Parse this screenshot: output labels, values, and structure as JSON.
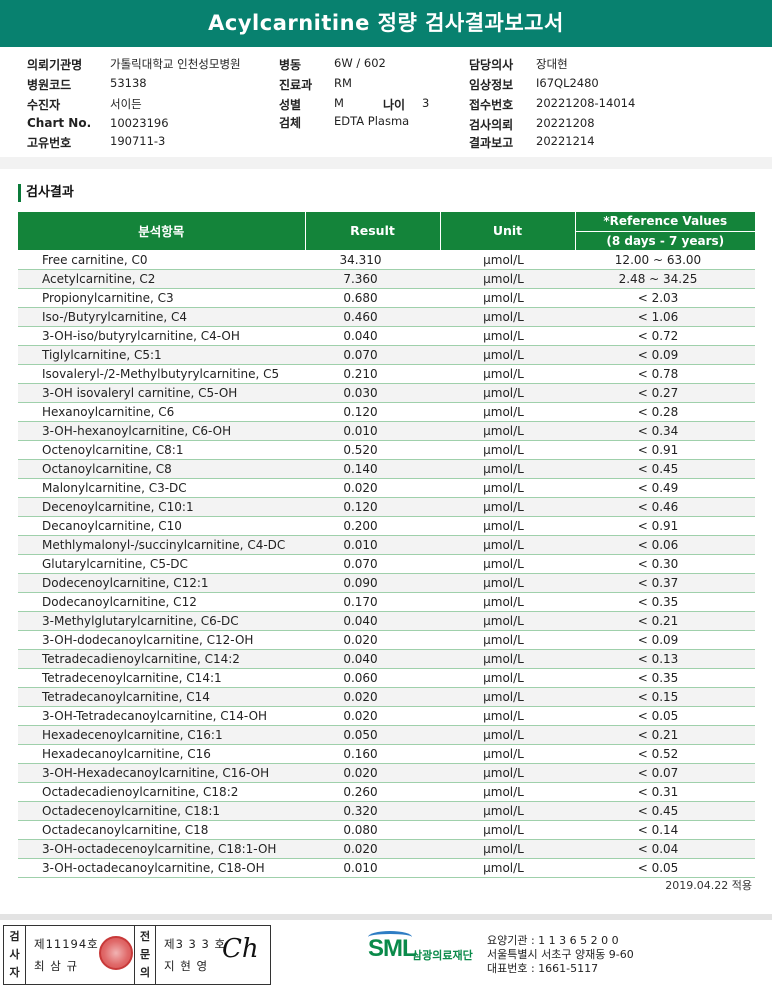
{
  "report": {
    "title": "Acylcarnitine 정량 검사결과보고서"
  },
  "patient_info": {
    "col1": [
      {
        "label": "의뢰기관명",
        "value": "가톨릭대학교 인천성모병원"
      },
      {
        "label": "병원코드",
        "value": "53138"
      },
      {
        "label": "수진자",
        "value": "서이든"
      },
      {
        "label": "Chart No.",
        "value": "10023196"
      },
      {
        "label": "고유번호",
        "value": "190711-3"
      }
    ],
    "col2": [
      {
        "label": "병동",
        "value": "6W / 602"
      },
      {
        "label": "진료과",
        "value": "RM"
      },
      {
        "label": "성별",
        "value": "M"
      },
      {
        "label": "검체",
        "value": "EDTA Plasma"
      }
    ],
    "age": {
      "label": "나이",
      "value": "3"
    },
    "col3": [
      {
        "label": "담당의사",
        "value": "장대현"
      },
      {
        "label": "임상정보",
        "value": "I67QL2480"
      },
      {
        "label": "접수번호",
        "value": "20221208-14014"
      },
      {
        "label": "검사의뢰",
        "value": "20221208"
      },
      {
        "label": "결과보고",
        "value": "20221214"
      }
    ]
  },
  "section": {
    "title": "검사결과"
  },
  "table": {
    "headers": {
      "item": "분석항목",
      "result": "Result",
      "unit": "Unit",
      "ref_title": "*Reference Values",
      "ref_range": "(8 days - 7 years)"
    },
    "rows": [
      {
        "name": "Free carnitine, C0",
        "result": "34.310",
        "unit": "μmol/L",
        "ref": "12.00 ~ 63.00"
      },
      {
        "name": "Acetylcarnitine, C2",
        "result": "7.360",
        "unit": "μmol/L",
        "ref": "2.48 ~ 34.25"
      },
      {
        "name": "Propionylcarnitine, C3",
        "result": "0.680",
        "unit": "μmol/L",
        "ref": "< 2.03"
      },
      {
        "name": "Iso-/Butyrylcarnitine, C4",
        "result": "0.460",
        "unit": "μmol/L",
        "ref": "< 1.06"
      },
      {
        "name": "3-OH-iso/butyrylcarnitine, C4-OH",
        "result": "0.040",
        "unit": "μmol/L",
        "ref": "< 0.72"
      },
      {
        "name": "Tiglylcarnitine, C5:1",
        "result": "0.070",
        "unit": "μmol/L",
        "ref": "< 0.09"
      },
      {
        "name": "Isovaleryl-/2-Methylbutyrylcarnitine, C5",
        "result": "0.210",
        "unit": "μmol/L",
        "ref": "< 0.78"
      },
      {
        "name": "3-OH isovaleryl carnitine, C5-OH",
        "result": "0.030",
        "unit": "μmol/L",
        "ref": "< 0.27"
      },
      {
        "name": "Hexanoylcarnitine, C6",
        "result": "0.120",
        "unit": "μmol/L",
        "ref": "< 0.28"
      },
      {
        "name": "3-OH-hexanoylcarnitine, C6-OH",
        "result": "0.010",
        "unit": "μmol/L",
        "ref": "< 0.34"
      },
      {
        "name": "Octenoylcarnitine, C8:1",
        "result": "0.520",
        "unit": "μmol/L",
        "ref": "< 0.91"
      },
      {
        "name": "Octanoylcarnitine, C8",
        "result": "0.140",
        "unit": "μmol/L",
        "ref": "< 0.45"
      },
      {
        "name": "Malonylcarnitine, C3-DC",
        "result": "0.020",
        "unit": "μmol/L",
        "ref": "< 0.49"
      },
      {
        "name": "Decenoylcarnitine, C10:1",
        "result": "0.120",
        "unit": "μmol/L",
        "ref": "< 0.46"
      },
      {
        "name": "Decanoylcarnitine, C10",
        "result": "0.200",
        "unit": "μmol/L",
        "ref": "< 0.91"
      },
      {
        "name": "Methlymalonyl-/succinylcarnitine, C4-DC",
        "result": "0.010",
        "unit": "μmol/L",
        "ref": "< 0.06"
      },
      {
        "name": "Glutarylcarnitine, C5-DC",
        "result": "0.070",
        "unit": "μmol/L",
        "ref": "< 0.30"
      },
      {
        "name": "Dodecenoylcarnitine, C12:1",
        "result": "0.090",
        "unit": "μmol/L",
        "ref": "< 0.37"
      },
      {
        "name": "Dodecanoylcarnitine, C12",
        "result": "0.170",
        "unit": "μmol/L",
        "ref": "< 0.35"
      },
      {
        "name": "3-Methylglutarylcarnitine, C6-DC",
        "result": "0.040",
        "unit": "μmol/L",
        "ref": "< 0.21"
      },
      {
        "name": "3-OH-dodecanoylcarnitine, C12-OH",
        "result": "0.020",
        "unit": "μmol/L",
        "ref": "< 0.09"
      },
      {
        "name": "Tetradecadienoylcarnitine, C14:2",
        "result": "0.040",
        "unit": "μmol/L",
        "ref": "< 0.13"
      },
      {
        "name": "Tetradecenoylcarnitine, C14:1",
        "result": "0.060",
        "unit": "μmol/L",
        "ref": "< 0.35"
      },
      {
        "name": "Tetradecanoylcarnitine, C14",
        "result": "0.020",
        "unit": "μmol/L",
        "ref": "< 0.15"
      },
      {
        "name": "3-OH-Tetradecanoylcarnitine, C14-OH",
        "result": "0.020",
        "unit": "μmol/L",
        "ref": "< 0.05"
      },
      {
        "name": "Hexadecenoylcarnitine, C16:1",
        "result": "0.050",
        "unit": "μmol/L",
        "ref": "< 0.21"
      },
      {
        "name": "Hexadecanoylcarnitine, C16",
        "result": "0.160",
        "unit": "μmol/L",
        "ref": "< 0.52"
      },
      {
        "name": "3-OH-Hexadecanoylcarnitine, C16-OH",
        "result": "0.020",
        "unit": "μmol/L",
        "ref": "< 0.07"
      },
      {
        "name": "Octadecadienoylcarnitine, C18:2",
        "result": "0.260",
        "unit": "μmol/L",
        "ref": "< 0.31"
      },
      {
        "name": "Octadecenoylcarnitine, C18:1",
        "result": "0.320",
        "unit": "μmol/L",
        "ref": "< 0.45"
      },
      {
        "name": "Octadecanoylcarnitine, C18",
        "result": "0.080",
        "unit": "μmol/L",
        "ref": "< 0.14"
      },
      {
        "name": "3-OH-octadecenoylcarnitine, C18:1-OH",
        "result": "0.020",
        "unit": "μmol/L",
        "ref": "< 0.04"
      },
      {
        "name": "3-OH-octadecanoylcarnitine, C18-OH",
        "result": "0.010",
        "unit": "μmol/L",
        "ref": "< 0.05"
      }
    ]
  },
  "applied_note": "2019.04.22 적용",
  "signatures": {
    "tester_label": "검사자",
    "tester_number": "제11194호",
    "tester_name": "최 삼 규",
    "reviewer_label": "전문의",
    "reviewer_number": "제3 3 3 호",
    "reviewer_name": "지 현 영",
    "signature_text": "Ch"
  },
  "organization": {
    "logo_text": "SML",
    "name": "삼광의료재단",
    "line1": "요양기관 : 1 1 3 6 5 2 0 0",
    "line2": "서울특별시 서초구 양재동 9-60",
    "line3": "대표번호 : 1661-5117"
  },
  "colors": {
    "title_bar": "#08816f",
    "table_header": "#14843a",
    "row_border": "#9fd0ab",
    "logo_green": "#0a8a4a",
    "seal_red": "#d54a4a"
  }
}
